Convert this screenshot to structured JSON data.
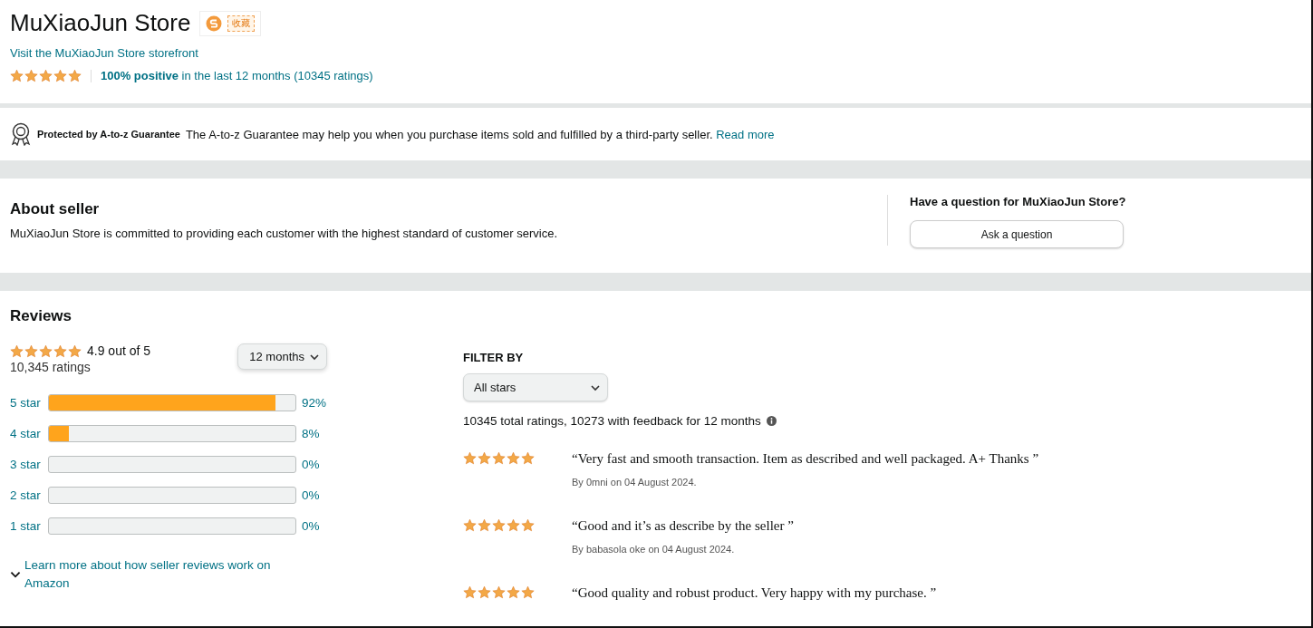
{
  "store": {
    "name": "MuXiaoJun Store",
    "badge": "收藏",
    "storefront_link": "Visit the MuXiaoJun Store storefront",
    "stars": 5,
    "positive": "100% positive",
    "positive_rest": "in the last 12 months (10345 ratings)"
  },
  "guarantee": {
    "title": "Protected by A-to-z Guarantee",
    "text": "The A-to-z Guarantee may help you when you purchase items sold and fulfilled by a third-party seller.",
    "link": "Read more"
  },
  "about": {
    "heading": "About seller",
    "text": "MuXiaoJun Store is committed to providing each customer with the highest standard of customer service.",
    "question": "Have a question for MuXiaoJun Store?",
    "ask_button": "Ask a question"
  },
  "reviews": {
    "heading": "Reviews",
    "stars": 5,
    "score": "4.9 out of  5",
    "count": "10,345 ratings",
    "period": "12 months",
    "histogram": [
      {
        "label": "5 star",
        "level": 0.92,
        "percent": "92%"
      },
      {
        "label": "4 star",
        "level": 0.08,
        "percent": "8%"
      },
      {
        "label": "3 star",
        "level": 0,
        "percent": "0%"
      },
      {
        "label": "2 star",
        "level": 0,
        "percent": "0%"
      },
      {
        "label": "1 star",
        "level": 0,
        "percent": "0%"
      }
    ],
    "learn_more": "Learn more about how seller reviews work on Amazon",
    "filter_label": "FILTER BY",
    "filter_value": "All stars",
    "summary": "10345 total ratings, 10273 with feedback for 12 months",
    "items": [
      {
        "stars": 5,
        "text": "“Very fast and smooth transaction. Item as described and well packaged. A+ Thanks ”",
        "byline": "By 0mni on 04 August 2024."
      },
      {
        "stars": 5,
        "text": "“Good and it’s as describe by the seller ”",
        "byline": "By babasola oke on 04 August 2024."
      },
      {
        "stars": 5,
        "text": "“Good quality and robust product. Very happy with my purchase. ”"
      }
    ]
  }
}
